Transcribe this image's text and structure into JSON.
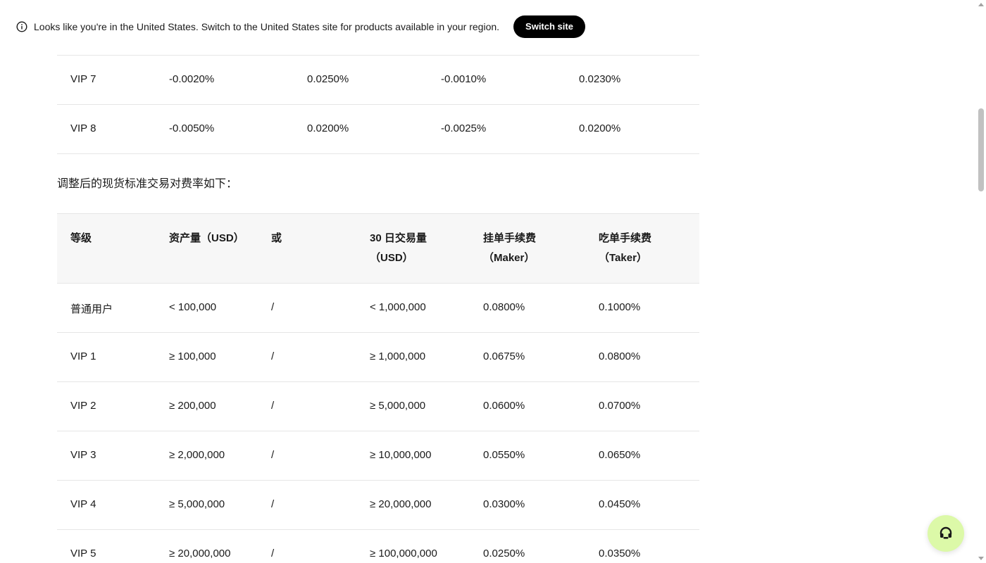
{
  "banner": {
    "message": "Looks like you're in the United States. Switch to the United States site for products available in your region.",
    "switch_label": "Switch site"
  },
  "prev_table": {
    "rows": [
      [
        "VIP 7",
        "-0.0020%",
        "0.0250%",
        "-0.0010%",
        "0.0230%"
      ],
      [
        "VIP 8",
        "-0.0050%",
        "0.0200%",
        "-0.0025%",
        "0.0200%"
      ]
    ]
  },
  "section_title": "调整后的现货标准交易对费率如下：",
  "fee_table": {
    "headers": [
      {
        "line1": "等级",
        "line2": ""
      },
      {
        "line1": "资产量（USD）",
        "line2": ""
      },
      {
        "line1": "或",
        "line2": ""
      },
      {
        "line1": "30 日交易量",
        "line2": "（USD）"
      },
      {
        "line1": "挂单手续费",
        "line2": "（Maker）"
      },
      {
        "line1": "吃单手续费",
        "line2": "（Taker）"
      }
    ],
    "rows": [
      [
        "普通用户",
        "< 100,000",
        "/",
        "< 1,000,000",
        "0.0800%",
        "0.1000%"
      ],
      [
        "VIP 1",
        "≥ 100,000",
        "/",
        "≥ 1,000,000",
        "0.0675%",
        "0.0800%"
      ],
      [
        "VIP 2",
        "≥ 200,000",
        "/",
        "≥ 5,000,000",
        "0.0600%",
        "0.0700%"
      ],
      [
        "VIP 3",
        "≥ 2,000,000",
        "/",
        "≥ 10,000,000",
        "0.0550%",
        "0.0650%"
      ],
      [
        "VIP 4",
        "≥ 5,000,000",
        "/",
        "≥ 20,000,000",
        "0.0300%",
        "0.0450%"
      ],
      [
        "VIP 5",
        "≥ 20,000,000",
        "/",
        "≥ 100,000,000",
        "0.0250%",
        "0.0350%"
      ]
    ]
  },
  "icons": {
    "info": "info-icon",
    "support": "headset-icon"
  },
  "colors": {
    "button_bg": "#000000",
    "fab_bg": "#dcf9a8",
    "header_bg": "#f7f7f7",
    "divider": "#e6e6e6"
  }
}
